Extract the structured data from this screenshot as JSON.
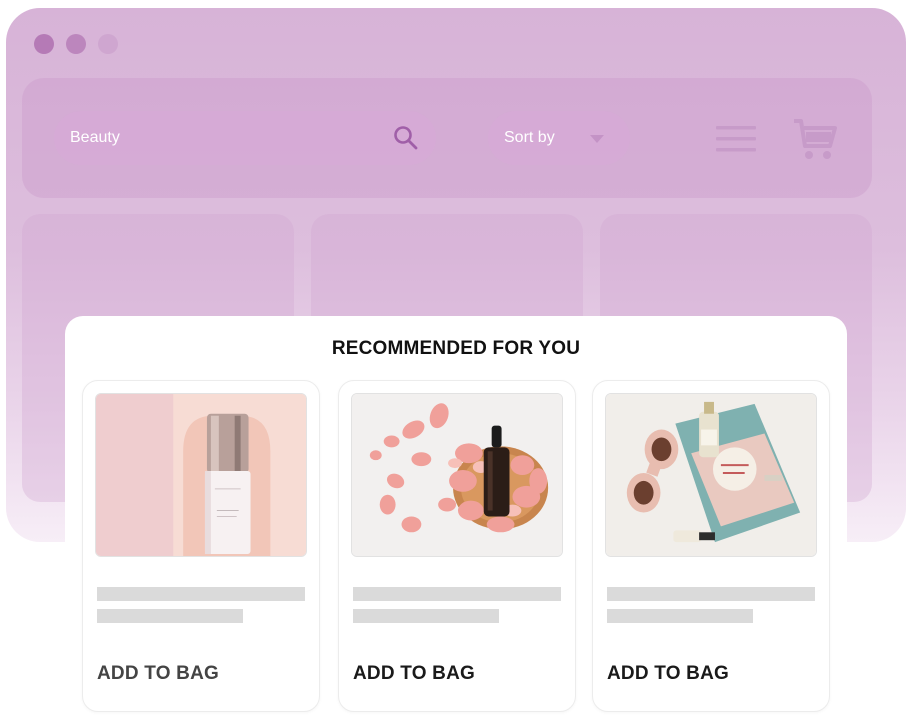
{
  "search": {
    "value": "Beauty"
  },
  "sort": {
    "label": "Sort by"
  },
  "recommended": {
    "title": "RECOMMENDED FOR YOU",
    "cards": [
      {
        "image": "serum-bottle-product-photo",
        "button": "ADD TO BAG"
      },
      {
        "image": "dropper-bottle-rose-petals-photo",
        "button": "ADD TO BAG"
      },
      {
        "image": "sunglasses-skincare-flatlay-photo",
        "button": "ADD TO BAG"
      }
    ]
  },
  "colors": {
    "browser_frame": "#d7b3d7",
    "accent_icon": "#a05fa8",
    "placeholder_line": "#dadada"
  }
}
